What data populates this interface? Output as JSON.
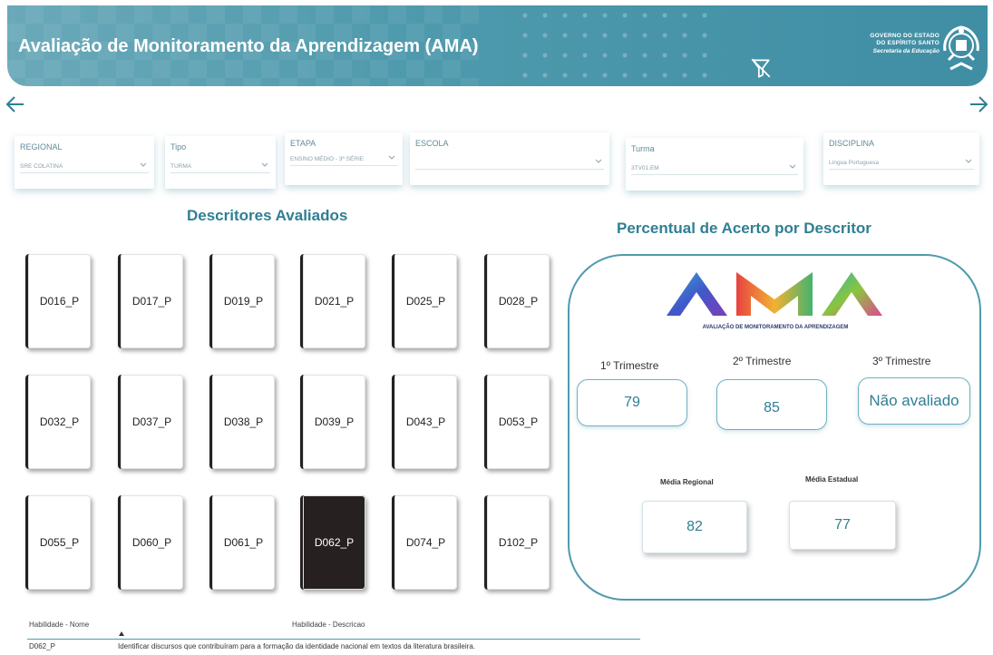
{
  "header": {
    "title": "Avaliação de Monitoramento da Aprendizagem (AMA)",
    "gov_line1": "GOVERNO DO ESTADO",
    "gov_line2": "DO ESPÍRITO SANTO",
    "gov_line3": "Secretaria da Educação",
    "icons": [
      "filter-off-icon",
      "state-emblem-icon"
    ]
  },
  "nav": {
    "icons": [
      "arrow-left-icon",
      "arrow-right-icon"
    ]
  },
  "filters": [
    {
      "label": "REGIONAL",
      "value": "SRE COLATINA"
    },
    {
      "label": "Tipo",
      "value": "TURMA"
    },
    {
      "label": "ETAPA",
      "value": "ENSINO MÉDIO - 3ª SÉRIE"
    },
    {
      "label": "ESCOLA",
      "value": ""
    },
    {
      "label": "Turma",
      "value": "3TV01.EM"
    },
    {
      "label": "DISCIPLINA",
      "value": "Língua Portuguesa"
    }
  ],
  "descritores": {
    "title": "Descritores Avaliados",
    "items": [
      "D016_P",
      "D017_P",
      "D019_P",
      "D021_P",
      "D025_P",
      "D028_P",
      "D032_P",
      "D037_P",
      "D038_P",
      "D039_P",
      "D043_P",
      "D053_P",
      "D055_P",
      "D060_P",
      "D061_P",
      "D062_P",
      "D074_P",
      "D102_P"
    ],
    "selected": "D062_P"
  },
  "percentual": {
    "title": "Percentual de Acerto por Descritor",
    "logo_text": "AMA",
    "logo_subtitle": "AVALIAÇÃO DE MONITORAMENTO DA APRENDIZAGEM",
    "trimestres": [
      {
        "label": "1º Trimestre",
        "value": "79"
      },
      {
        "label": "2º Trimestre",
        "value": "85"
      },
      {
        "label": "3º Trimestre",
        "value": "Não avaliado"
      }
    ],
    "media_regional": {
      "label": "Média Regional",
      "value": "82"
    },
    "media_estadual": {
      "label": "Média Estadual",
      "value": "77"
    }
  },
  "table": {
    "columns": [
      "Habilidade - Nome",
      "Habilidade - Descricao"
    ],
    "rows": [
      [
        "D062_P",
        "Identificar discursos que contribuíram para a formação da identidade nacional em textos da literatura brasileira."
      ]
    ]
  },
  "colors": {
    "accent": "#2f7f93",
    "header": "#4f9aad",
    "selected_card": "#262120"
  }
}
